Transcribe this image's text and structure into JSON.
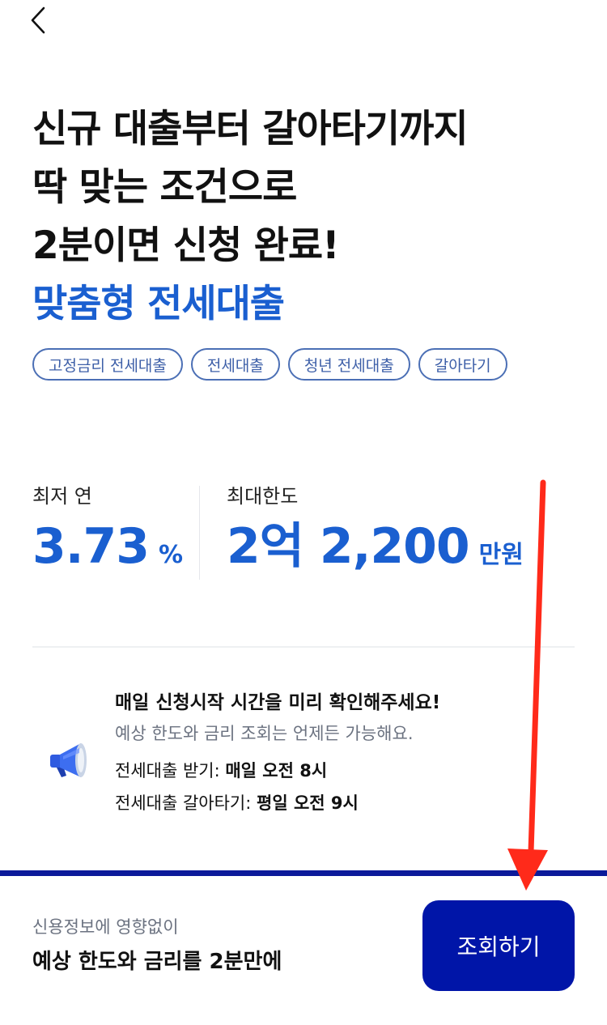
{
  "header": {
    "back_icon": "chevron-left-icon"
  },
  "headline": {
    "lines": [
      "신규 대출부터 갈아타기까지",
      "딱 맞는 조건으로",
      "2분이면 신청 완료!"
    ],
    "highlight": "맞춤형 전세대출"
  },
  "tags": [
    "고정금리 전세대출",
    "전세대출",
    "청년 전세대출",
    "갈아타기"
  ],
  "stats": {
    "rate": {
      "label": "최저 연",
      "value": "3.73",
      "unit": "%"
    },
    "limit": {
      "label": "최대한도",
      "value": "2억 2,200",
      "unit": "만원"
    }
  },
  "notice": {
    "icon": "megaphone-icon",
    "title": "매일 신청시작 시간을 미리 확인해주세요!",
    "subtitle": "예상 한도와 금리 조회는 언제든 가능해요.",
    "rows": [
      {
        "label": "전세대출 받기: ",
        "value": "매일 오전 8시"
      },
      {
        "label": "전세대출 갈아타기: ",
        "value": "평일 오전 9시"
      }
    ]
  },
  "bottom": {
    "sub": "신용정보에 영향없이",
    "main": "예상 한도와 금리를 2분만에",
    "button_label": "조회하기"
  },
  "colors": {
    "accent_blue": "#1a5fd0",
    "cta_navy": "#0015a8",
    "bar_border": "#0b1a9a",
    "annotation_arrow": "#ff2a1a"
  }
}
